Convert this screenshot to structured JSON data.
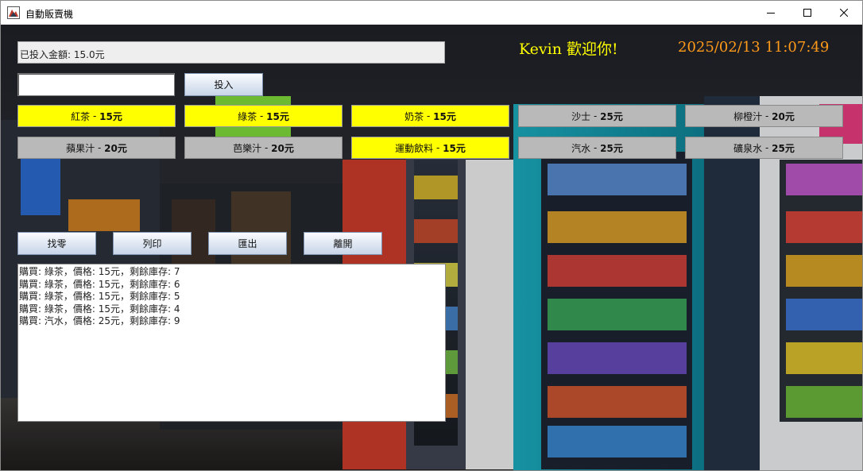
{
  "window": {
    "title": "自動販賣機"
  },
  "amount": {
    "text": "已投入金額: 15.0元"
  },
  "welcome": "Kevin  歡迎你!",
  "clock": "2025/02/13 11:07:49",
  "money_input": {
    "value": ""
  },
  "insert_button": "投入",
  "products": [
    {
      "name": "紅茶",
      "price": "15元",
      "available": true
    },
    {
      "name": "綠茶",
      "price": "15元",
      "available": true
    },
    {
      "name": "奶茶",
      "price": "15元",
      "available": true
    },
    {
      "name": "沙士",
      "price": "25元",
      "available": false
    },
    {
      "name": "柳橙汁",
      "price": "20元",
      "available": false
    },
    {
      "name": "蘋果汁",
      "price": "20元",
      "available": false
    },
    {
      "name": "芭樂汁",
      "price": "20元",
      "available": false
    },
    {
      "name": "運動飲料",
      "price": "15元",
      "available": true
    },
    {
      "name": "汽水",
      "price": "25元",
      "available": false
    },
    {
      "name": "礦泉水",
      "price": "25元",
      "available": false
    }
  ],
  "actions": {
    "change": "找零",
    "print": "列印",
    "export": "匯出",
    "exit": "離開"
  },
  "log": [
    "購買: 綠茶，價格: 15元，剩餘庫存: 7",
    "購買: 綠茶，價格: 15元，剩餘庫存: 6",
    "購買: 綠茶，價格: 15元，剩餘庫存: 5",
    "購買: 綠茶，價格: 15元，剩餘庫存: 4",
    "購買: 汽水，價格: 25元，剩餘庫存: 9"
  ],
  "colors": {
    "available": "#ffff00",
    "unavailable": "#b9b9b9",
    "welcome": "#ffff00",
    "clock": "#ff9a1a"
  }
}
